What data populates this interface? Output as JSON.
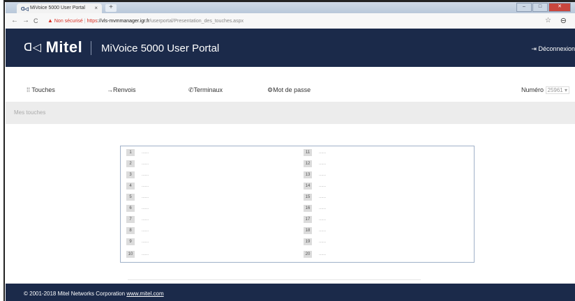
{
  "browser": {
    "tab_title": "MiVoice 5000 User Portal",
    "tab_close": "×",
    "new_tab": "+",
    "win_minimize": "–",
    "win_maximize": "□",
    "win_close": "✕",
    "back": "←",
    "forward": "→",
    "reload": "C",
    "security_warning_icon": "▲",
    "security_label": "Non sécurisé",
    "url_scheme": "https",
    "url_host": "://vls-mvmmanager.igr.fr",
    "url_path": "/userportal/Presentation_des_touches.aspx",
    "bookmark": "☆",
    "account": "⊖"
  },
  "header": {
    "logo_mark": "ᗡ◁",
    "logo_text": "Mitel",
    "app_title": "MiVoice 5000 User Portal",
    "logout_label": "Déconnexion"
  },
  "menu": {
    "items": [
      {
        "label": "Touches",
        "icon": "grid-icon"
      },
      {
        "label": "Renvois",
        "icon": "arrow-right-icon"
      },
      {
        "label": "Terminaux",
        "icon": "phone-icon"
      },
      {
        "label": "Mot de passe",
        "icon": "gear-icon"
      }
    ],
    "numero_label": "Numéro",
    "numero_value": "25961"
  },
  "subheader": {
    "label": "Mes touches"
  },
  "keys": {
    "left": [
      {
        "num": "1",
        "value": "......"
      },
      {
        "num": "2",
        "value": "......"
      },
      {
        "num": "3",
        "value": "......"
      },
      {
        "num": "4",
        "value": "......"
      },
      {
        "num": "5",
        "value": "......"
      },
      {
        "num": "6",
        "value": "......"
      },
      {
        "num": "7",
        "value": "......"
      },
      {
        "num": "8",
        "value": "......"
      },
      {
        "num": "9",
        "value": "......"
      },
      {
        "num": "10",
        "value": "......"
      }
    ],
    "right": [
      {
        "num": "11",
        "value": "......"
      },
      {
        "num": "12",
        "value": "......"
      },
      {
        "num": "13",
        "value": "......"
      },
      {
        "num": "14",
        "value": "......"
      },
      {
        "num": "15",
        "value": "......"
      },
      {
        "num": "16",
        "value": "......"
      },
      {
        "num": "17",
        "value": "......"
      },
      {
        "num": "18",
        "value": "......"
      },
      {
        "num": "19",
        "value": "......"
      },
      {
        "num": "20",
        "value": "......"
      }
    ]
  },
  "footer": {
    "copyright": "© 2001-2018 Mitel Networks Corporation",
    "link": "www.mitel.com"
  },
  "colors": {
    "brand_navy": "#1b2a4a",
    "security_red": "#d93025"
  }
}
